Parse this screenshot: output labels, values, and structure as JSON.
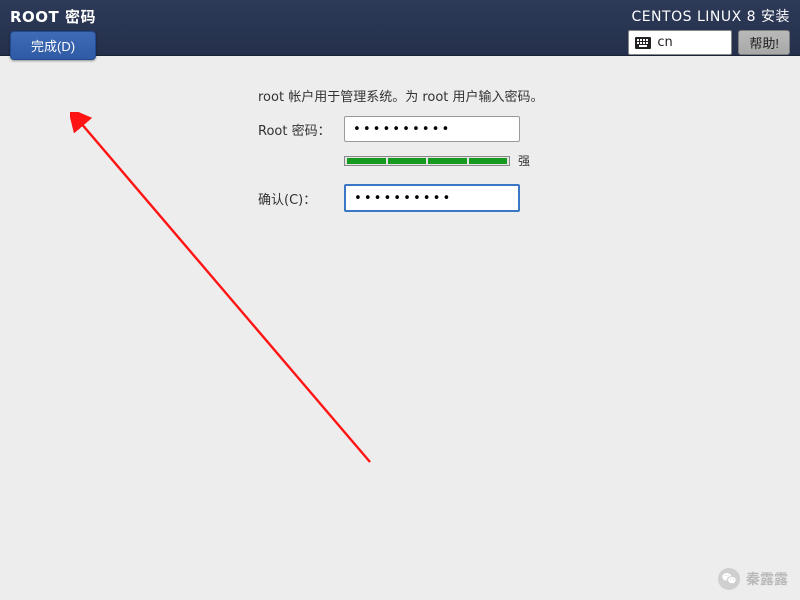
{
  "header": {
    "title": "ROOT 密码",
    "done_label": "完成(D)",
    "product": "CENTOS LINUX 8 安装",
    "lang_code": "cn",
    "help_label": "帮助!"
  },
  "form": {
    "instructions": "root 帐户用于管理系统。为 root 用户输入密码。",
    "password_label": "Root 密码：",
    "password_value": "••••••••••",
    "confirm_label": "确认(C)：",
    "confirm_value": "••••••••••",
    "strength_text": "强"
  },
  "watermark": {
    "author": "秦露露"
  }
}
